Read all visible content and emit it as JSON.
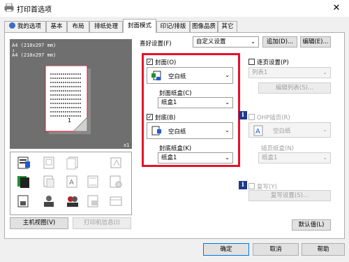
{
  "window": {
    "title": "打印首选项",
    "close_glyph": "✕"
  },
  "tabs": [
    {
      "label": "我的选项",
      "active": false
    },
    {
      "label": "基本",
      "active": false
    },
    {
      "label": "布局",
      "active": false
    },
    {
      "label": "排纸处理",
      "active": false
    },
    {
      "label": "封面模式",
      "active": true
    },
    {
      "label": "印记/排版",
      "active": false
    },
    {
      "label": "图像品质",
      "active": false
    },
    {
      "label": "其它",
      "active": false
    }
  ],
  "preview": {
    "paper_line1": "A4 (210x297 mm)",
    "arrow": "↓",
    "paper_line2": "A4 (210x297 mm)",
    "page_number": "1",
    "count": "x1"
  },
  "left_buttons": {
    "printer_view": "主机视图(V)",
    "printer_info": "打印机信息(I)"
  },
  "favorites": {
    "label": "喜好设置(F)",
    "value": "自定义设置",
    "add": "追加(D)...",
    "edit": "编辑(E)..."
  },
  "front_cover": {
    "label": "封面(O)",
    "checked": true,
    "paper_type": "空白纸",
    "tray_label": "封面纸盒(C)",
    "tray_value": "纸盒1"
  },
  "back_cover": {
    "label": "封底(B)",
    "checked": true,
    "paper_type": "空白纸",
    "tray_label": "封底纸盒(K)",
    "tray_value": "纸盒1"
  },
  "per_page": {
    "label": "逐页设置(P)",
    "checked": false,
    "list_value": "列表1",
    "edit_list": "编辑列表(S)..."
  },
  "ohp": {
    "label": "OHP插页(R)",
    "checked": false,
    "paper_type": "空白纸",
    "tray_label": "插页纸盒(N)",
    "tray_value": "纸盒1"
  },
  "carbon": {
    "label": "复写(Y)",
    "checked": false,
    "settings": "复写设置(S)..."
  },
  "defaults_button": "默认值(L)",
  "footer": {
    "ok": "确定",
    "cancel": "取消",
    "help": "帮助"
  },
  "colors": {
    "highlight": "#e8102a",
    "preview_bg": "#6f6f6f",
    "info_icon": "#1e3a8a"
  }
}
